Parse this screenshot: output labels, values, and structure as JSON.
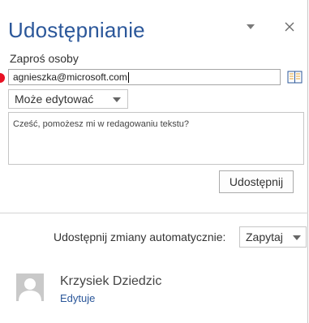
{
  "pane": {
    "title": "Udostępnianie",
    "menu_icon": "chevron-down-icon",
    "close_icon": "close-icon"
  },
  "invite": {
    "label": "Zaproś osoby",
    "email_value": "agnieszka@microsoft.com",
    "address_book_icon": "address-book-icon",
    "permission_selected": "Może edytować",
    "message_value": "Cześć, pomożesz mi w redagowaniu tekstu?",
    "share_label": "Udostępnij"
  },
  "auto_share": {
    "label": "Udostępnij zmiany automatycznie:",
    "selected": "Zapytaj"
  },
  "people": [
    {
      "name": "Krzysiek Dziedzic",
      "role": "Edytuje"
    }
  ],
  "colors": {
    "accent": "#2b579a",
    "marker": "#e81123"
  }
}
